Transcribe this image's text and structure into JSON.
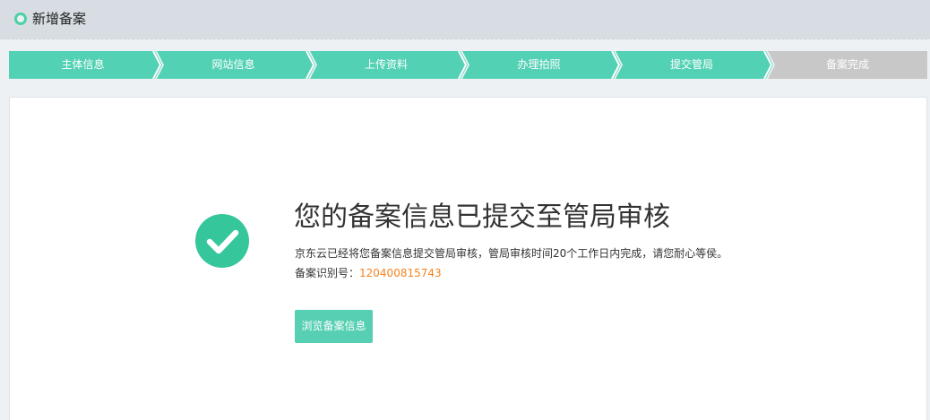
{
  "header": {
    "title": "新增备案",
    "icon": "circle-outline-icon"
  },
  "steps": [
    {
      "label": "主体信息",
      "status": "done"
    },
    {
      "label": "网站信息",
      "status": "done"
    },
    {
      "label": "上传资料",
      "status": "done"
    },
    {
      "label": "办理拍照",
      "status": "done"
    },
    {
      "label": "提交管局",
      "status": "done"
    },
    {
      "label": "备案完成",
      "status": "pending"
    }
  ],
  "colors": {
    "step_done": "#53d1b4",
    "step_pending": "#c8c8c8",
    "accent": "#56cfb2",
    "success_icon": "#36c69b",
    "id_highlight": "#f5831f"
  },
  "result": {
    "icon": "check-circle-icon",
    "title": "您的备案信息已提交至管局审核",
    "description": "京东云已经将您备案信息提交管局审核，管局审核时间20个工作日内完成，请您耐心等侯。",
    "id_label": "备案识别号：",
    "id_value": "120400815743",
    "browse_button": "浏览备案信息"
  }
}
